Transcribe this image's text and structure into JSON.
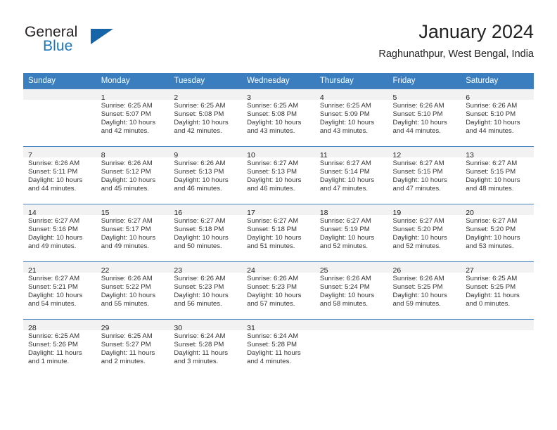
{
  "brand": {
    "name_top": "General",
    "name_bottom": "Blue",
    "accent_color": "#1a76bc",
    "triangle_color": "#1565a8"
  },
  "header": {
    "month_title": "January 2024",
    "location": "Raghunathpur, West Bengal, India"
  },
  "calendar": {
    "header_bg": "#3a7ebf",
    "header_text_color": "#ffffff",
    "daynum_strip_bg": "#f2f2f2",
    "row_border_color": "#4a87c3",
    "weekday_headers": [
      "Sunday",
      "Monday",
      "Tuesday",
      "Wednesday",
      "Thursday",
      "Friday",
      "Saturday"
    ],
    "weeks": [
      [
        {
          "day": "",
          "lines": []
        },
        {
          "day": "1",
          "lines": [
            "Sunrise: 6:25 AM",
            "Sunset: 5:07 PM",
            "Daylight: 10 hours",
            "and 42 minutes."
          ]
        },
        {
          "day": "2",
          "lines": [
            "Sunrise: 6:25 AM",
            "Sunset: 5:08 PM",
            "Daylight: 10 hours",
            "and 42 minutes."
          ]
        },
        {
          "day": "3",
          "lines": [
            "Sunrise: 6:25 AM",
            "Sunset: 5:08 PM",
            "Daylight: 10 hours",
            "and 43 minutes."
          ]
        },
        {
          "day": "4",
          "lines": [
            "Sunrise: 6:25 AM",
            "Sunset: 5:09 PM",
            "Daylight: 10 hours",
            "and 43 minutes."
          ]
        },
        {
          "day": "5",
          "lines": [
            "Sunrise: 6:26 AM",
            "Sunset: 5:10 PM",
            "Daylight: 10 hours",
            "and 44 minutes."
          ]
        },
        {
          "day": "6",
          "lines": [
            "Sunrise: 6:26 AM",
            "Sunset: 5:10 PM",
            "Daylight: 10 hours",
            "and 44 minutes."
          ]
        }
      ],
      [
        {
          "day": "7",
          "lines": [
            "Sunrise: 6:26 AM",
            "Sunset: 5:11 PM",
            "Daylight: 10 hours",
            "and 44 minutes."
          ]
        },
        {
          "day": "8",
          "lines": [
            "Sunrise: 6:26 AM",
            "Sunset: 5:12 PM",
            "Daylight: 10 hours",
            "and 45 minutes."
          ]
        },
        {
          "day": "9",
          "lines": [
            "Sunrise: 6:26 AM",
            "Sunset: 5:13 PM",
            "Daylight: 10 hours",
            "and 46 minutes."
          ]
        },
        {
          "day": "10",
          "lines": [
            "Sunrise: 6:27 AM",
            "Sunset: 5:13 PM",
            "Daylight: 10 hours",
            "and 46 minutes."
          ]
        },
        {
          "day": "11",
          "lines": [
            "Sunrise: 6:27 AM",
            "Sunset: 5:14 PM",
            "Daylight: 10 hours",
            "and 47 minutes."
          ]
        },
        {
          "day": "12",
          "lines": [
            "Sunrise: 6:27 AM",
            "Sunset: 5:15 PM",
            "Daylight: 10 hours",
            "and 47 minutes."
          ]
        },
        {
          "day": "13",
          "lines": [
            "Sunrise: 6:27 AM",
            "Sunset: 5:15 PM",
            "Daylight: 10 hours",
            "and 48 minutes."
          ]
        }
      ],
      [
        {
          "day": "14",
          "lines": [
            "Sunrise: 6:27 AM",
            "Sunset: 5:16 PM",
            "Daylight: 10 hours",
            "and 49 minutes."
          ]
        },
        {
          "day": "15",
          "lines": [
            "Sunrise: 6:27 AM",
            "Sunset: 5:17 PM",
            "Daylight: 10 hours",
            "and 49 minutes."
          ]
        },
        {
          "day": "16",
          "lines": [
            "Sunrise: 6:27 AM",
            "Sunset: 5:18 PM",
            "Daylight: 10 hours",
            "and 50 minutes."
          ]
        },
        {
          "day": "17",
          "lines": [
            "Sunrise: 6:27 AM",
            "Sunset: 5:18 PM",
            "Daylight: 10 hours",
            "and 51 minutes."
          ]
        },
        {
          "day": "18",
          "lines": [
            "Sunrise: 6:27 AM",
            "Sunset: 5:19 PM",
            "Daylight: 10 hours",
            "and 52 minutes."
          ]
        },
        {
          "day": "19",
          "lines": [
            "Sunrise: 6:27 AM",
            "Sunset: 5:20 PM",
            "Daylight: 10 hours",
            "and 52 minutes."
          ]
        },
        {
          "day": "20",
          "lines": [
            "Sunrise: 6:27 AM",
            "Sunset: 5:20 PM",
            "Daylight: 10 hours",
            "and 53 minutes."
          ]
        }
      ],
      [
        {
          "day": "21",
          "lines": [
            "Sunrise: 6:27 AM",
            "Sunset: 5:21 PM",
            "Daylight: 10 hours",
            "and 54 minutes."
          ]
        },
        {
          "day": "22",
          "lines": [
            "Sunrise: 6:26 AM",
            "Sunset: 5:22 PM",
            "Daylight: 10 hours",
            "and 55 minutes."
          ]
        },
        {
          "day": "23",
          "lines": [
            "Sunrise: 6:26 AM",
            "Sunset: 5:23 PM",
            "Daylight: 10 hours",
            "and 56 minutes."
          ]
        },
        {
          "day": "24",
          "lines": [
            "Sunrise: 6:26 AM",
            "Sunset: 5:23 PM",
            "Daylight: 10 hours",
            "and 57 minutes."
          ]
        },
        {
          "day": "25",
          "lines": [
            "Sunrise: 6:26 AM",
            "Sunset: 5:24 PM",
            "Daylight: 10 hours",
            "and 58 minutes."
          ]
        },
        {
          "day": "26",
          "lines": [
            "Sunrise: 6:26 AM",
            "Sunset: 5:25 PM",
            "Daylight: 10 hours",
            "and 59 minutes."
          ]
        },
        {
          "day": "27",
          "lines": [
            "Sunrise: 6:25 AM",
            "Sunset: 5:25 PM",
            "Daylight: 11 hours",
            "and 0 minutes."
          ]
        }
      ],
      [
        {
          "day": "28",
          "lines": [
            "Sunrise: 6:25 AM",
            "Sunset: 5:26 PM",
            "Daylight: 11 hours",
            "and 1 minute."
          ]
        },
        {
          "day": "29",
          "lines": [
            "Sunrise: 6:25 AM",
            "Sunset: 5:27 PM",
            "Daylight: 11 hours",
            "and 2 minutes."
          ]
        },
        {
          "day": "30",
          "lines": [
            "Sunrise: 6:24 AM",
            "Sunset: 5:28 PM",
            "Daylight: 11 hours",
            "and 3 minutes."
          ]
        },
        {
          "day": "31",
          "lines": [
            "Sunrise: 6:24 AM",
            "Sunset: 5:28 PM",
            "Daylight: 11 hours",
            "and 4 minutes."
          ]
        },
        {
          "day": "",
          "lines": []
        },
        {
          "day": "",
          "lines": []
        },
        {
          "day": "",
          "lines": []
        }
      ]
    ]
  }
}
